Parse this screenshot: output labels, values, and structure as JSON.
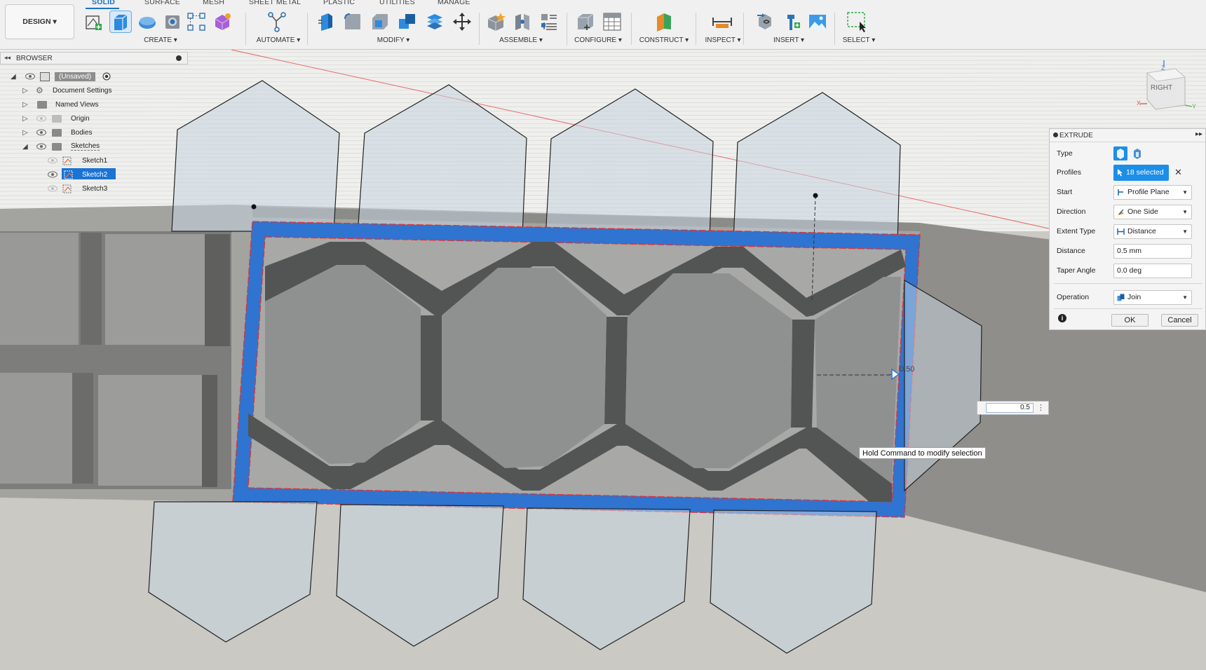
{
  "toolbar": {
    "design_label": "DESIGN ▾",
    "tabs": [
      "SOLID",
      "SURFACE",
      "MESH",
      "SHEET METAL",
      "PLASTIC",
      "UTILITIES",
      "MANAGE"
    ],
    "groups": {
      "create": "CREATE ▾",
      "automate": "AUTOMATE ▾",
      "modify": "MODIFY ▾",
      "assemble": "ASSEMBLE ▾",
      "configure": "CONFIGURE ▾",
      "construct": "CONSTRUCT ▾",
      "inspect": "INSPECT ▾",
      "insert": "INSERT ▾",
      "select": "SELECT ▾"
    }
  },
  "browser": {
    "title": "BROWSER",
    "items": [
      {
        "label": "(Unsaved)",
        "level": 0
      },
      {
        "label": "Document Settings",
        "level": 1
      },
      {
        "label": "Named Views",
        "level": 1
      },
      {
        "label": "Origin",
        "level": 1
      },
      {
        "label": "Bodies",
        "level": 1
      },
      {
        "label": "Sketches",
        "level": 1
      },
      {
        "label": "Sketch1",
        "level": 2
      },
      {
        "label": "Sketch2",
        "level": 2,
        "selected": true
      },
      {
        "label": "Sketch3",
        "level": 2
      }
    ]
  },
  "extrude": {
    "title": "EXTRUDE",
    "type_label": "Type",
    "profiles_label": "Profiles",
    "profiles_value": "18 selected",
    "start_label": "Start",
    "start_value": "Profile Plane",
    "direction_label": "Direction",
    "direction_value": "One Side",
    "extent_label": "Extent Type",
    "extent_value": "Distance",
    "distance_label": "Distance",
    "distance_value": "0.5 mm",
    "taper_label": "Taper Angle",
    "taper_value": "0.0 deg",
    "operation_label": "Operation",
    "operation_value": "Join",
    "ok_label": "OK",
    "cancel_label": "Cancel"
  },
  "viewcube": {
    "face": "RIGHT",
    "z": "Z",
    "x": "X",
    "y": "Y"
  },
  "value_input": "0.5",
  "tooltip": "Hold Command to modify selection",
  "manipulator_label": "0.50",
  "colors": {
    "accent": "#1b8ee8",
    "selection": "#2f74d0",
    "toolbar_bg": "#f0f0f0"
  }
}
